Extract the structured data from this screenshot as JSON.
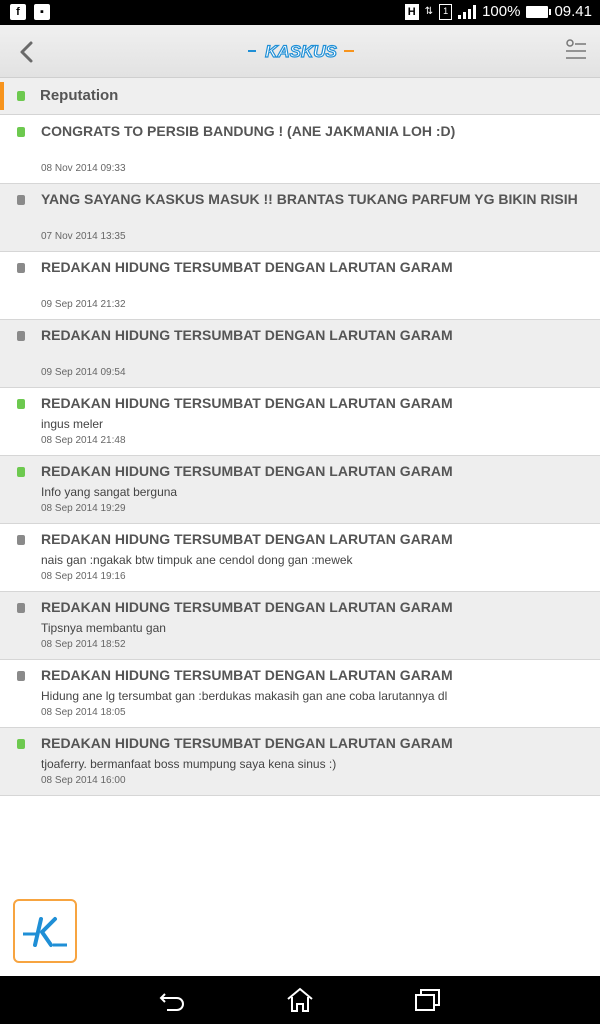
{
  "status_bar": {
    "battery": "100%",
    "time": "09.41",
    "h_label": "H",
    "sim_label": "1"
  },
  "header": {
    "logo_text": "KASKUS"
  },
  "section": {
    "title": "Reputation",
    "dot_color": "#6dc94f"
  },
  "colors": {
    "positive": "#6dc94f",
    "neutral": "#8a8a8a",
    "accent": "#f7941d",
    "kaskus_blue": "#1f8fd6"
  },
  "items": [
    {
      "title": "CONGRATS TO PERSIB BANDUNG ! (ANE JAKMANIA LOH :D)",
      "snippet": "",
      "date": "08 Nov 2014 09:33",
      "status": "positive"
    },
    {
      "title": "YANG SAYANG KASKUS MASUK !! BRANTAS TUKANG PARFUM YG BIKIN RISIH",
      "snippet": "",
      "date": "07 Nov 2014 13:35",
      "status": "neutral"
    },
    {
      "title": "REDAKAN HIDUNG TERSUMBAT DENGAN LARUTAN GARAM",
      "snippet": "",
      "date": "09 Sep 2014 21:32",
      "status": "neutral"
    },
    {
      "title": "REDAKAN HIDUNG TERSUMBAT DENGAN LARUTAN GARAM",
      "snippet": "",
      "date": "09 Sep 2014 09:54",
      "status": "neutral"
    },
    {
      "title": "REDAKAN HIDUNG TERSUMBAT DENGAN LARUTAN GARAM",
      "snippet": "ingus meler",
      "date": "08 Sep 2014 21:48",
      "status": "positive"
    },
    {
      "title": "REDAKAN HIDUNG TERSUMBAT DENGAN LARUTAN GARAM",
      "snippet": "Info yang sangat berguna",
      "date": "08 Sep 2014 19:29",
      "status": "positive"
    },
    {
      "title": "REDAKAN HIDUNG TERSUMBAT DENGAN LARUTAN GARAM",
      "snippet": "nais gan :ngakak btw timpuk ane cendol dong gan :mewek",
      "date": "08 Sep 2014 19:16",
      "status": "neutral"
    },
    {
      "title": "REDAKAN HIDUNG TERSUMBAT DENGAN LARUTAN GARAM",
      "snippet": "Tipsnya membantu gan",
      "date": "08 Sep 2014 18:52",
      "status": "neutral"
    },
    {
      "title": "REDAKAN HIDUNG TERSUMBAT DENGAN LARUTAN GARAM",
      "snippet": "Hidung ane lg tersumbat gan :berdukas makasih gan ane coba larutannya dl",
      "date": "08 Sep 2014 18:05",
      "status": "neutral"
    },
    {
      "title": "REDAKAN HIDUNG TERSUMBAT DENGAN LARUTAN GARAM",
      "snippet": "tjoaferry. bermanfaat boss mumpung saya kena sinus :)",
      "date": "08 Sep 2014 16:00",
      "status": "positive"
    }
  ],
  "icons": {
    "back": "back-arrow-icon",
    "menu": "menu-list-icon",
    "fab": "kaskus-k-icon",
    "nav_back": "nav-back-icon",
    "nav_home": "nav-home-icon",
    "nav_recent": "nav-recent-apps-icon"
  }
}
